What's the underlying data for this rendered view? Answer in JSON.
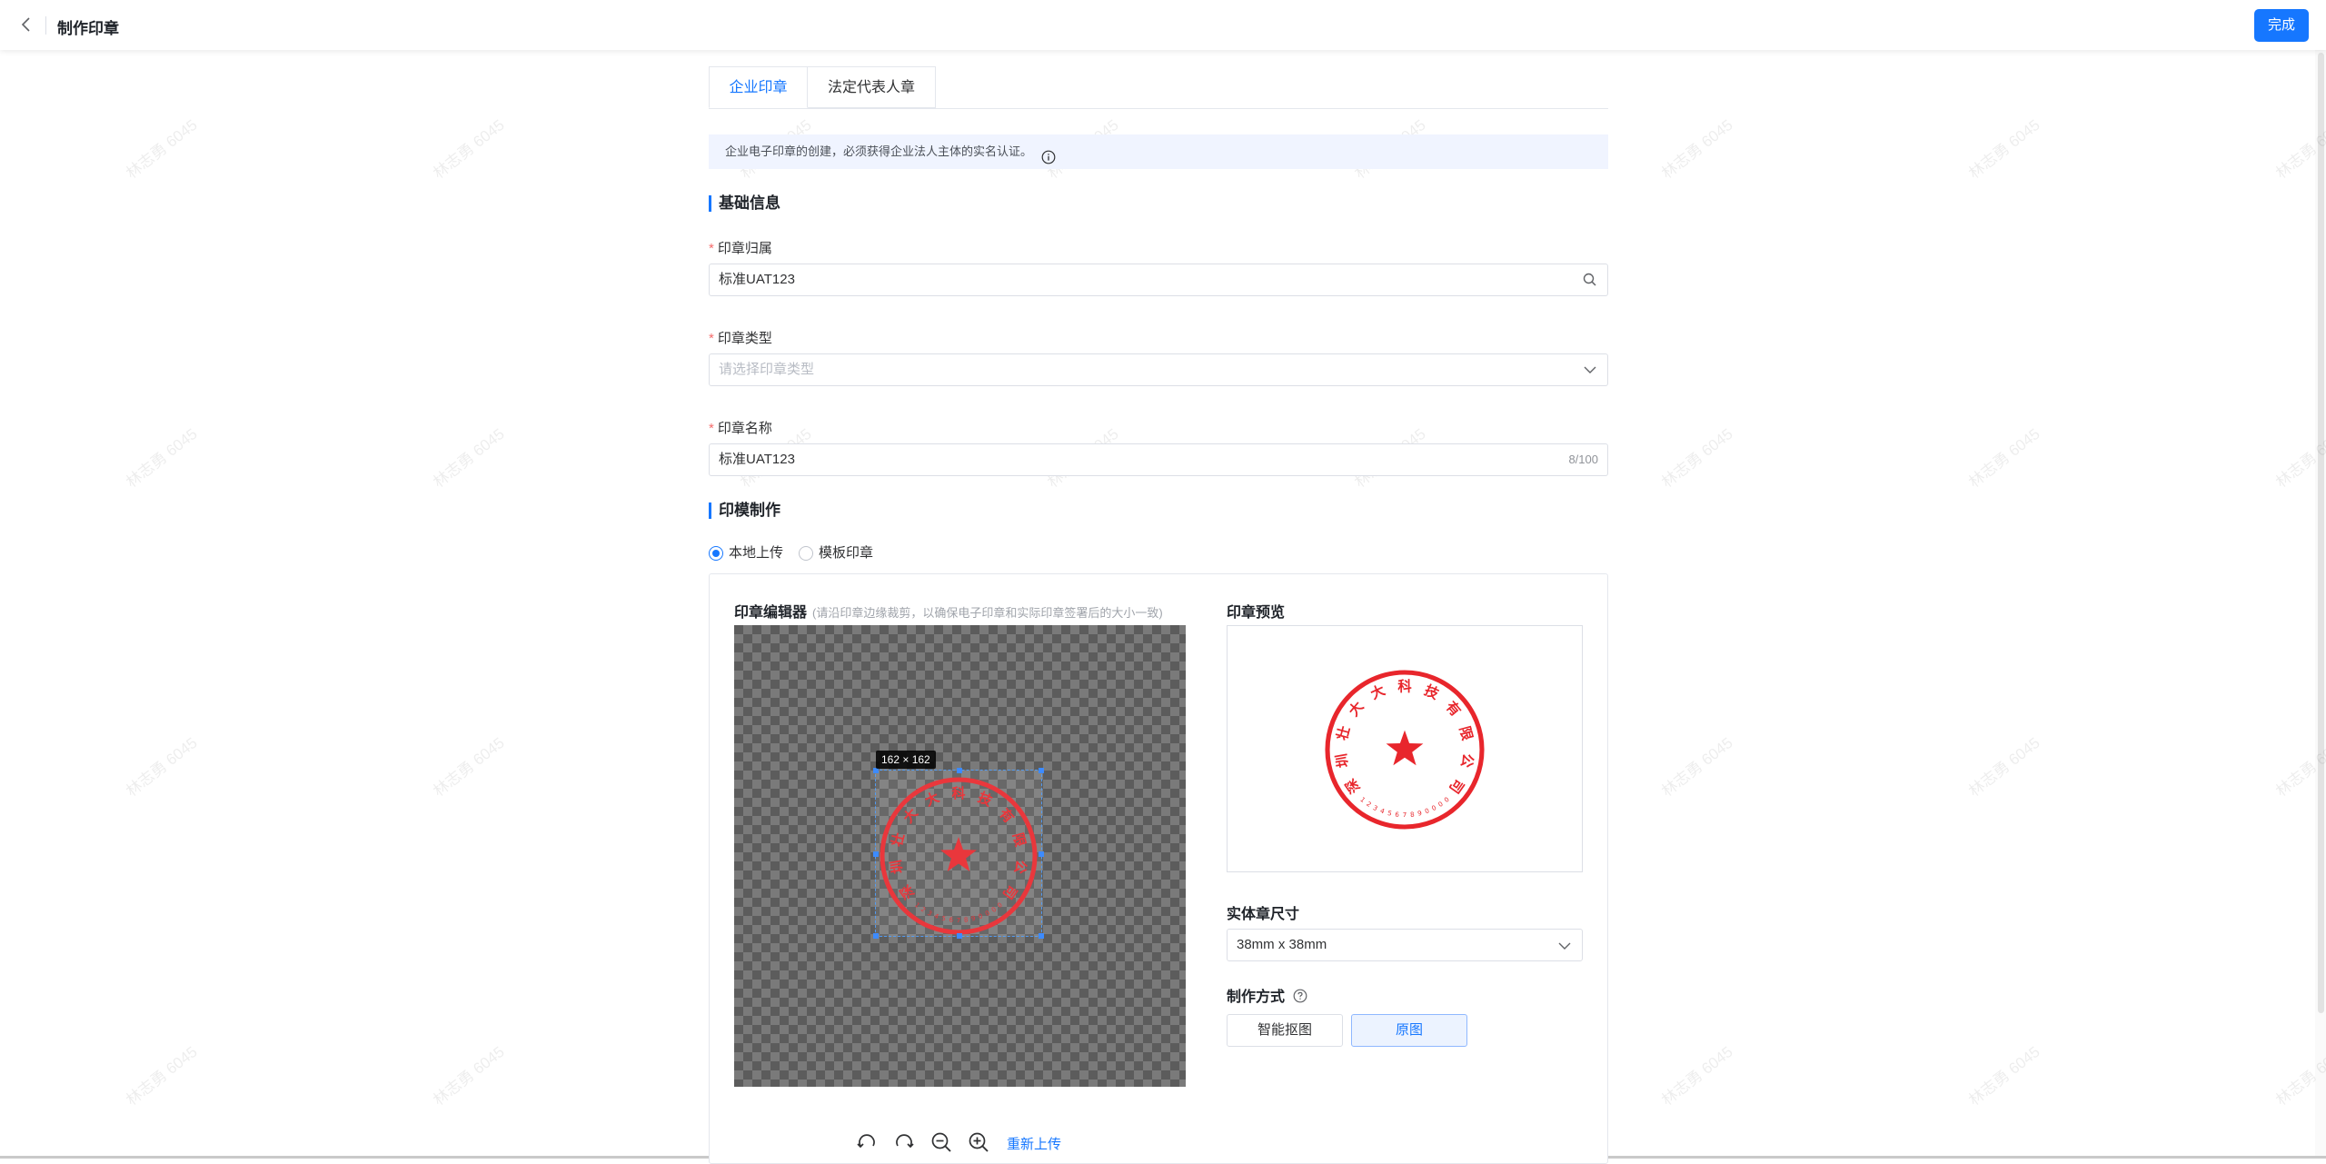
{
  "header": {
    "title": "制作印章",
    "done_label": "完成"
  },
  "tabs": [
    {
      "label": "企业印章",
      "active": true
    },
    {
      "label": "法定代表人章",
      "active": false
    }
  ],
  "notice": "企业电子印章的创建，必须获得企业法人主体的实名认证。",
  "basic_section_title": "基础信息",
  "fields": {
    "owner": {
      "label": "印章归属",
      "value": "标准UAT123"
    },
    "type": {
      "label": "印章类型",
      "placeholder": "请选择印章类型"
    },
    "name": {
      "label": "印章名称",
      "value": "标准UAT123",
      "count": "8/100"
    }
  },
  "mold_section_title": "印模制作",
  "upload_mode": {
    "options": [
      "本地上传",
      "模板印章"
    ],
    "selected": "本地上传"
  },
  "editor": {
    "title": "印章编辑器",
    "hint": "(请沿印章边缘裁剪，以确保电子印章和实际印章签署后的大小一致)",
    "crop_size": "162 × 162",
    "reupload_label": "重新上传"
  },
  "stamp": {
    "company": "深圳壮大大科技有限公司",
    "code": "1234567890000",
    "color": "#e8262c"
  },
  "preview_title": "印章预览",
  "physical_size": {
    "label": "实体章尺寸",
    "value": "38mm x 38mm"
  },
  "method": {
    "label": "制作方式",
    "options": [
      "智能抠图",
      "原图"
    ],
    "selected": "原图"
  },
  "watermark_text": "林志勇 6045",
  "colors": {
    "primary": "#1677ff",
    "required": "#f56c6c",
    "notice_bg": "#f0f4ff"
  }
}
